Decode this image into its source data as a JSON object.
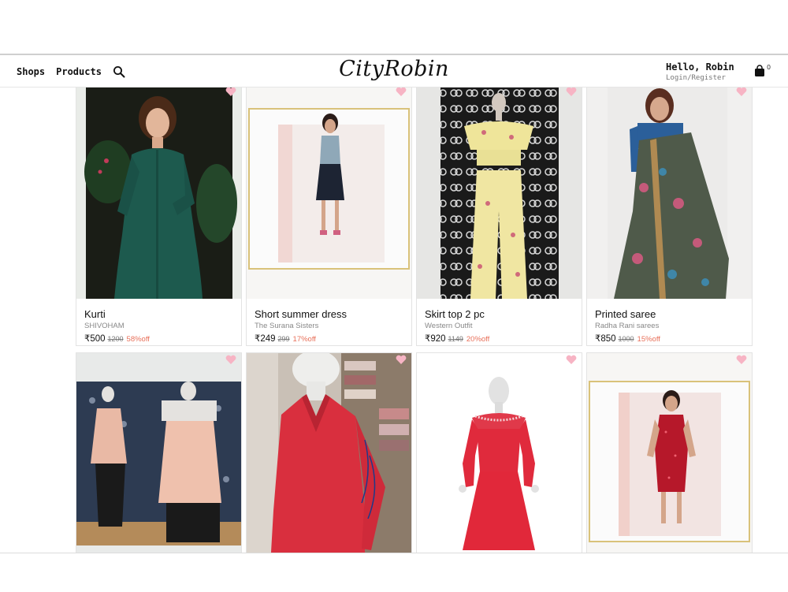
{
  "header": {
    "nav": {
      "shops": "Shops",
      "products": "Products"
    },
    "logo": "CityRobin",
    "user": {
      "greeting": "Hello, Robin",
      "login": "Login/Register"
    },
    "cart_count": "0"
  },
  "products": [
    {
      "name": "Kurti",
      "brand": "SHIVOHAM",
      "price": "₹500",
      "original": "1200",
      "discount": "58%off"
    },
    {
      "name": "Short summer dress",
      "brand": "The Surana Sisters",
      "price": "₹249",
      "original": "299",
      "discount": "17%off"
    },
    {
      "name": "Skirt top 2 pc",
      "brand": "Western Outfit",
      "price": "₹920",
      "original": "1149",
      "discount": "20%off"
    },
    {
      "name": "Printed saree",
      "brand": "Radha Rani sarees",
      "price": "₹850",
      "original": "1000",
      "discount": "15%off"
    }
  ],
  "colors": {
    "heart": "#f7b4c4",
    "discount": "#e8705a",
    "text": "#111111"
  }
}
